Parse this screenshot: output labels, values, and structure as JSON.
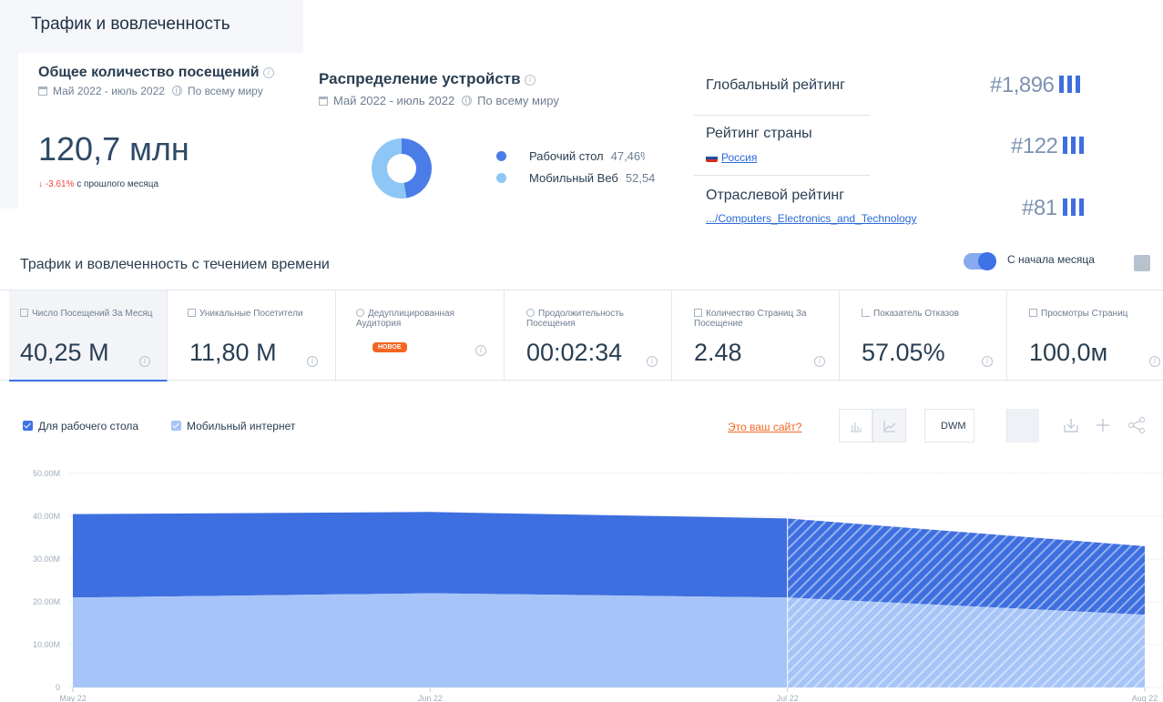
{
  "header": {
    "title": "Трафик и вовлеченность"
  },
  "visits_card": {
    "title": "Общее количество посещений",
    "date_range": "Май 2022 - июль 2022",
    "region": "По всему миру",
    "value": "120,7 млн",
    "change_pct": "↓ -3.61%",
    "change_label": "с прошлого месяца"
  },
  "devices": {
    "title": "Распределение устройств",
    "date_range": "Май 2022 - июль 2022",
    "region": "По всему миру",
    "items": [
      {
        "label": "Рабочий стол",
        "value": "47,46%",
        "share": 0.4746,
        "color": "#4a7de8"
      },
      {
        "label": "Мобильный Веб",
        "value": "52,54",
        "share": 0.5254,
        "color": "#8ec7f5"
      }
    ]
  },
  "rankings": {
    "global": {
      "label": "Глобальный рейтинг",
      "value": "#1,896"
    },
    "country": {
      "label": "Рейтинг страны",
      "link": "Россия",
      "value": "#122"
    },
    "industry": {
      "label": "Отраслевой рейтинг",
      "link": ".../Computers_Electronics_and_Technology",
      "value": "#81"
    }
  },
  "section2": {
    "title": "Трафик и вовлеченность с течением времени",
    "toggle_label": "С начала месяца"
  },
  "metrics": [
    {
      "label": "Число Посещений За Месяц",
      "value": "40,25 M"
    },
    {
      "label": "Уникальные Посетители",
      "value": "11,80 M"
    },
    {
      "label": "Дедуплицированная Аудитория",
      "badge": "НОВОЕ"
    },
    {
      "label": "Продолжительность Посещения",
      "value": "00:02:34"
    },
    {
      "label": "Количество Страниц За Посещение",
      "value": "2.48"
    },
    {
      "label": "Показатель Отказов",
      "value": "57.05%"
    },
    {
      "label": "Просмотры Страниц",
      "value": "100,0м"
    }
  ],
  "chart_toolbar": {
    "legend_desktop": "Для рабочего стола",
    "legend_mobile": "Мобильный интернет",
    "your_site_link": "Это ваш сайт?",
    "granularity": "DWM"
  },
  "chart_data": {
    "type": "area",
    "stacked": true,
    "x": [
      "May 22",
      "Jun 22",
      "Jul 22",
      "Aug 22"
    ],
    "ylim": [
      0,
      50000000
    ],
    "yticks": [
      "0",
      "10.00M",
      "20.00M",
      "30.00M",
      "40.00M",
      "50.00M"
    ],
    "series": [
      {
        "name": "Мобильный интернет",
        "values": [
          21000000,
          22000000,
          21000000,
          17000000
        ],
        "color": "#a6c4f7"
      },
      {
        "name": "Для рабочего стола",
        "values": [
          19500000,
          19000000,
          18500000,
          16000000
        ],
        "color": "#3e6fe0"
      }
    ],
    "projected_from": "Jul 22"
  }
}
